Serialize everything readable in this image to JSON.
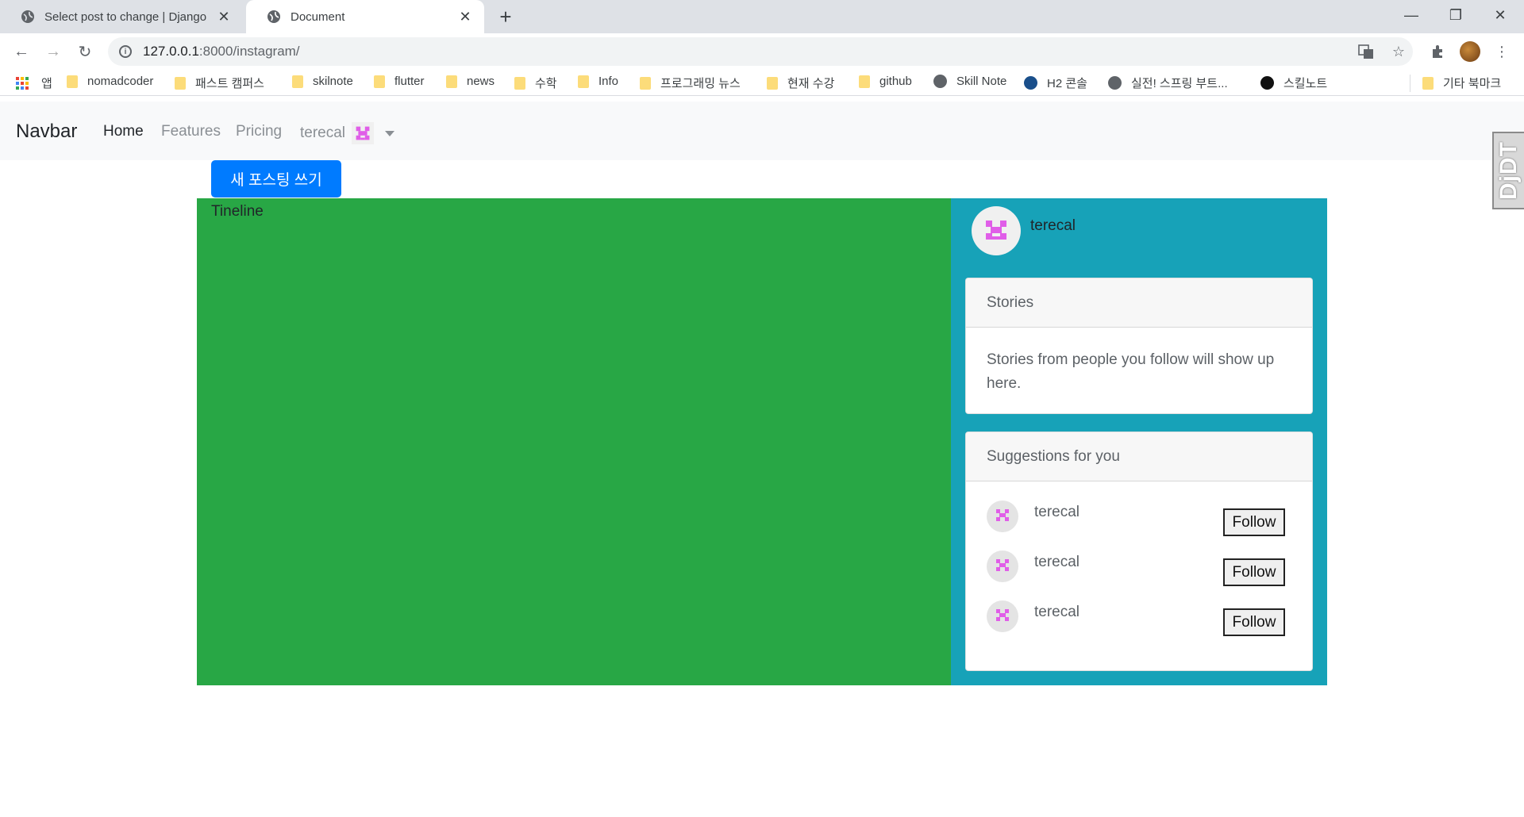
{
  "browser": {
    "tabs": [
      {
        "title": "Select post to change | Django",
        "active": false
      },
      {
        "title": "Document",
        "active": true
      }
    ],
    "url_host": "127.0.0.1",
    "url_path": ":8000/instagram/",
    "bookmarks": [
      {
        "label": "앱",
        "icon": "apps-icon"
      },
      {
        "label": "nomadcoder",
        "icon": "folder-icon"
      },
      {
        "label": "패스트 캠퍼스",
        "icon": "folder-icon"
      },
      {
        "label": "skilnote",
        "icon": "folder-icon"
      },
      {
        "label": "flutter",
        "icon": "folder-icon"
      },
      {
        "label": "news",
        "icon": "folder-icon"
      },
      {
        "label": "수학",
        "icon": "folder-icon"
      },
      {
        "label": "Info",
        "icon": "folder-icon"
      },
      {
        "label": "프로그래밍 뉴스",
        "icon": "folder-icon"
      },
      {
        "label": "현재 수강",
        "icon": "folder-icon"
      },
      {
        "label": "github",
        "icon": "folder-icon"
      },
      {
        "label": "Skill Note",
        "icon": "globe-icon"
      },
      {
        "label": "H2 콘솔",
        "icon": "h2-icon"
      },
      {
        "label": "실전! 스프링 부트...",
        "icon": "globe-icon"
      },
      {
        "label": "스킬노트",
        "icon": "github-icon"
      },
      {
        "label": "기타 북마크",
        "icon": "folder-icon"
      }
    ]
  },
  "navbar": {
    "brand": "Navbar",
    "links": [
      "Home",
      "Features",
      "Pricing"
    ],
    "user": "terecal"
  },
  "djdt": "DjDT",
  "new_post_button": "새 포스팅 쓰기",
  "timeline": {
    "title": "Tineline"
  },
  "sidebar": {
    "user": "terecal",
    "stories": {
      "title": "Stories",
      "body": "Stories from people you follow will show up here."
    },
    "suggestions": {
      "title": "Suggestions for you",
      "users": [
        {
          "name": "terecal",
          "button": "Follow"
        },
        {
          "name": "terecal",
          "button": "Follow"
        },
        {
          "name": "terecal",
          "button": "Follow"
        }
      ]
    }
  },
  "colors": {
    "primary": "#007bff",
    "timeline_bg": "#28a745",
    "sidebar_bg": "#17a2b8",
    "avatar_pink": "#e05ee8"
  }
}
